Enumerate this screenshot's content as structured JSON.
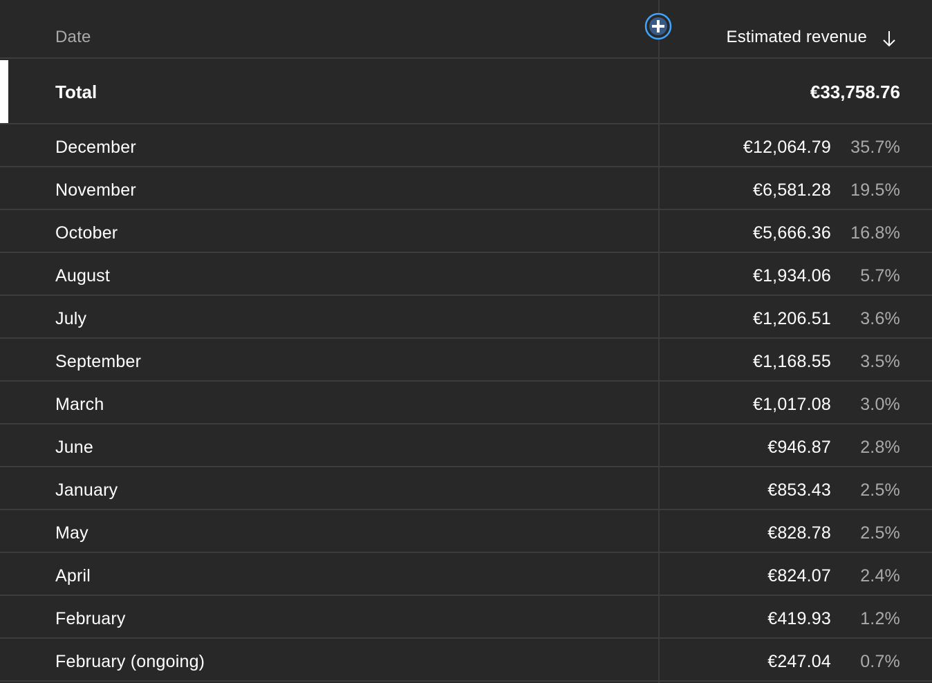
{
  "header": {
    "date_label": "Date",
    "revenue_label": "Estimated revenue"
  },
  "icons": {
    "add_column": "add-circle-icon",
    "sort": "arrow-down-icon"
  },
  "colors": {
    "background": "#282828",
    "accent": "#3ea6ff",
    "muted_text": "#aaaaaa"
  },
  "total": {
    "label": "Total",
    "value": "€33,758.76"
  },
  "rows": [
    {
      "label": "December",
      "value": "€12,064.79",
      "pct": "35.7%"
    },
    {
      "label": "November",
      "value": "€6,581.28",
      "pct": "19.5%"
    },
    {
      "label": "October",
      "value": "€5,666.36",
      "pct": "16.8%"
    },
    {
      "label": "August",
      "value": "€1,934.06",
      "pct": "5.7%"
    },
    {
      "label": "July",
      "value": "€1,206.51",
      "pct": "3.6%"
    },
    {
      "label": "September",
      "value": "€1,168.55",
      "pct": "3.5%"
    },
    {
      "label": "March",
      "value": "€1,017.08",
      "pct": "3.0%"
    },
    {
      "label": "June",
      "value": "€946.87",
      "pct": "2.8%"
    },
    {
      "label": "January",
      "value": "€853.43",
      "pct": "2.5%"
    },
    {
      "label": "May",
      "value": "€828.78",
      "pct": "2.5%"
    },
    {
      "label": "April",
      "value": "€824.07",
      "pct": "2.4%"
    },
    {
      "label": "February",
      "value": "€419.93",
      "pct": "1.2%"
    },
    {
      "label": "February (ongoing)",
      "value": "€247.04",
      "pct": "0.7%"
    }
  ]
}
